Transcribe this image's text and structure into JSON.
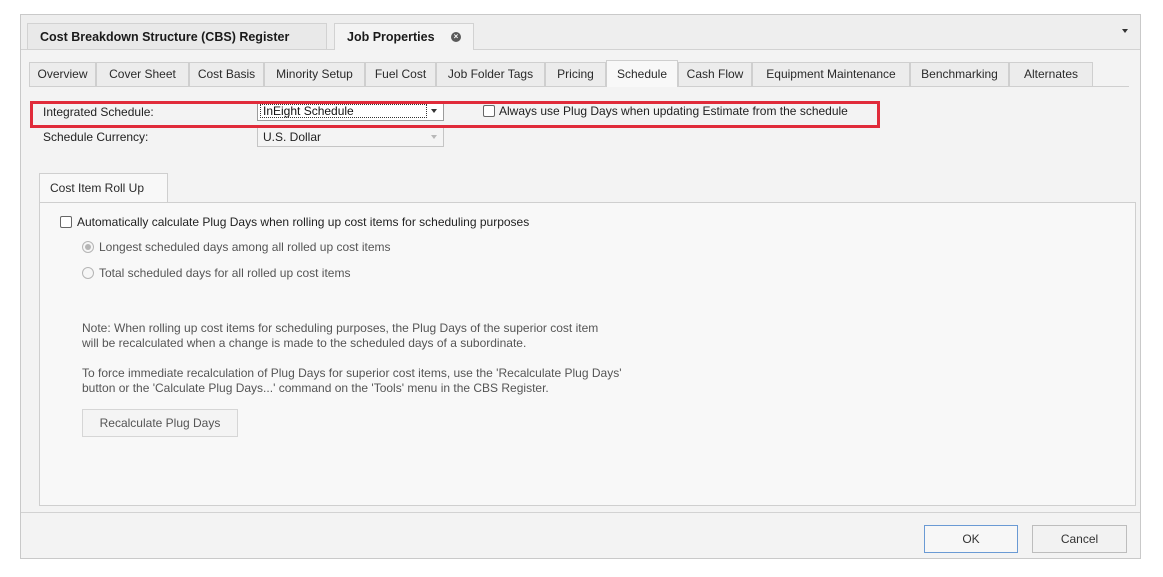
{
  "doc_tabs": [
    {
      "label": "Cost Breakdown Structure (CBS) Register"
    },
    {
      "label": "Job Properties"
    }
  ],
  "property_tabs": [
    {
      "label": "Overview"
    },
    {
      "label": "Cover Sheet"
    },
    {
      "label": "Cost Basis"
    },
    {
      "label": "Minority Setup"
    },
    {
      "label": "Fuel Cost"
    },
    {
      "label": "Job Folder Tags"
    },
    {
      "label": "Pricing"
    },
    {
      "label": "Schedule",
      "active": true
    },
    {
      "label": "Cash Flow"
    },
    {
      "label": "Equipment Maintenance"
    },
    {
      "label": "Benchmarking"
    },
    {
      "label": "Alternates"
    }
  ],
  "schedule": {
    "integrated_label": "Integrated Schedule:",
    "integrated_value": "InEight Schedule",
    "plug_days_checkbox_label": "Always use Plug Days when updating Estimate from the schedule",
    "currency_label": "Schedule Currency:",
    "currency_value": "U.S. Dollar"
  },
  "rollup": {
    "tab_label": "Cost Item Roll Up",
    "auto_calc_label": "Automatically calculate Plug Days when rolling up cost items for scheduling purposes",
    "option_longest": "Longest scheduled days among all rolled up cost items",
    "option_total": "Total scheduled days for all rolled up cost items",
    "note_line1": "Note:  When rolling up cost items for scheduling purposes, the Plug Days of the superior cost item",
    "note_line2": "will be recalculated when a change is made to the scheduled days of a subordinate.",
    "force_line1": "To force immediate recalculation of Plug Days for superior cost items, use the 'Recalculate Plug Days'",
    "force_line2": "button or the 'Calculate Plug Days...' command on the 'Tools' menu in the CBS Register.",
    "recalc_button": "Recalculate Plug Days"
  },
  "footer": {
    "ok": "OK",
    "cancel": "Cancel"
  },
  "colors": {
    "highlight": "#e02b3a"
  }
}
